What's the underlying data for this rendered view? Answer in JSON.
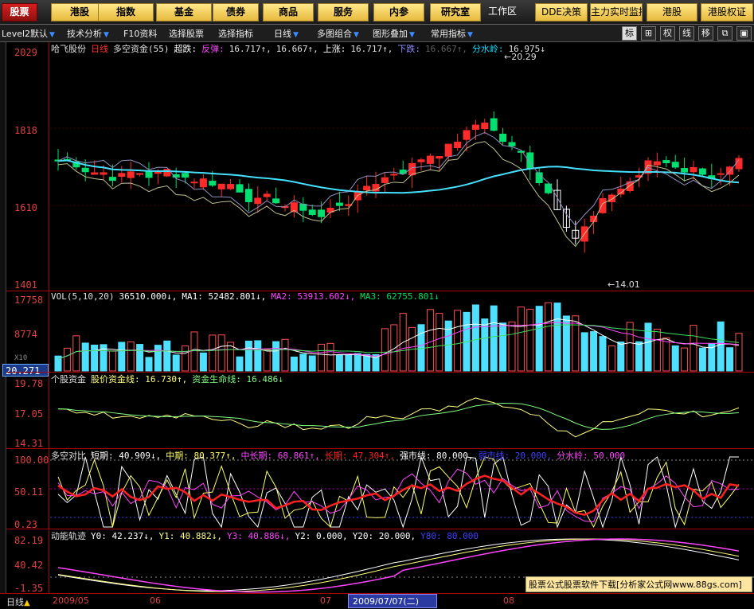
{
  "topbar": {
    "buttons": [
      "股票",
      "港股",
      "指数",
      "基金",
      "债券",
      "商品",
      "服务",
      "内参",
      "研究室"
    ],
    "workarea": "工作区",
    "right_buttons": [
      "DDE决策",
      "主力实时监控",
      "港股",
      "港股权证"
    ]
  },
  "toolbar": {
    "items": [
      "Level2默认",
      "技术分析",
      "F10资料",
      "选择股票",
      "选择指标",
      "日线",
      "多图组合",
      "图形叠加",
      "常用指标"
    ],
    "right_buttons": [
      "标",
      "⊞",
      "权",
      "线",
      "移",
      "⧉",
      "▣"
    ]
  },
  "colors": {
    "up": "#ff2a2a",
    "down": "#00e070",
    "ma_cyan": "#44e0ff",
    "axis": "#e04040",
    "bg": "#000000"
  },
  "price_panel": {
    "stock_name": "哈飞股份",
    "period": "日线",
    "indicator": "多空资金(55)",
    "items": [
      {
        "text": "超跌:",
        "color": "#ffffff"
      },
      {
        "text": "反弹:",
        "color": "#ff44ff"
      },
      {
        "text": "16.717↑,",
        "color": "#e0e0e0"
      },
      {
        "text": "16.667↑,",
        "color": "#e0e0e0"
      },
      {
        "text": "上涨:",
        "color": "#ffffff"
      },
      {
        "text": "16.717↑,",
        "color": "#e0e0e0"
      },
      {
        "text": "下跌:",
        "color": "#9090ff"
      },
      {
        "text": "16.667↑,",
        "color": "#606060"
      },
      {
        "text": "分水岭:",
        "color": "#00e0ff"
      },
      {
        "text": "16.975↓",
        "color": "#e0e0e0"
      }
    ],
    "axis_labels": [
      "2029",
      "1818",
      "1610",
      "1401"
    ],
    "high_marker": "20.29",
    "low_marker": "14.01"
  },
  "vol_panel": {
    "label": "VOL(5,10,20)",
    "values": [
      {
        "text": "36510.000↓,",
        "color": "#ffffff"
      },
      {
        "text": "MA1: 52482.801↓,",
        "color": "#ffffff"
      },
      {
        "text": "MA2: 53913.602↓,",
        "color": "#ff44ff"
      },
      {
        "text": "MA3: 62755.801↓",
        "color": "#00e060"
      }
    ],
    "axis_labels": [
      "17758",
      "8774",
      "X10"
    ]
  },
  "cursor_value": "20.271",
  "fund_panel": {
    "label": "个股资金",
    "values": [
      {
        "text": "股价资金线: 16.730↑,",
        "color": "#ffff80"
      },
      {
        "text": "资金生命线: 16.486↓",
        "color": "#80ff80"
      }
    ],
    "axis_labels": [
      "19.78",
      "17.05",
      "14.31"
    ]
  },
  "ls_panel": {
    "label": "多空对比",
    "values": [
      {
        "text": "短期: 40.909↓,",
        "color": "#ffffff"
      },
      {
        "text": "中期: 80.377↑,",
        "color": "#ffff60"
      },
      {
        "text": "中长期: 68.861↑,",
        "color": "#ff44ff"
      },
      {
        "text": "长期: 47.304↑,",
        "color": "#ff2020"
      },
      {
        "text": "强市线: 80.000,",
        "color": "#ffffff"
      },
      {
        "text": "弱市线: 20.000,",
        "color": "#4040ff"
      },
      {
        "text": "分水岭: 50.000",
        "color": "#ff44ff"
      }
    ],
    "axis_labels": [
      "100.00",
      "50.11",
      "0.23"
    ]
  },
  "mom_panel": {
    "label": "动能轨迹",
    "values": [
      {
        "text": "Y0: 42.237↓,",
        "color": "#ffffff"
      },
      {
        "text": "Y1: 40.882↓,",
        "color": "#ffff80"
      },
      {
        "text": "Y3: 40.886↓,",
        "color": "#ff44ff"
      },
      {
        "text": "Y2: 0.000,",
        "color": "#ffffff"
      },
      {
        "text": "Y20: 20.000,",
        "color": "#ffffff"
      },
      {
        "text": "Y80: 80.000",
        "color": "#4040ff"
      }
    ],
    "axis_labels": [
      "82.19",
      "40.42",
      "-1.35"
    ]
  },
  "bottom": {
    "period_label": "日线",
    "dates": [
      "2009/05",
      "06",
      "07",
      "08"
    ],
    "current_date": "2009/07/07(二)",
    "promo": "股票公式股票软件下载[分析家公式网www.88gs.com]"
  }
}
